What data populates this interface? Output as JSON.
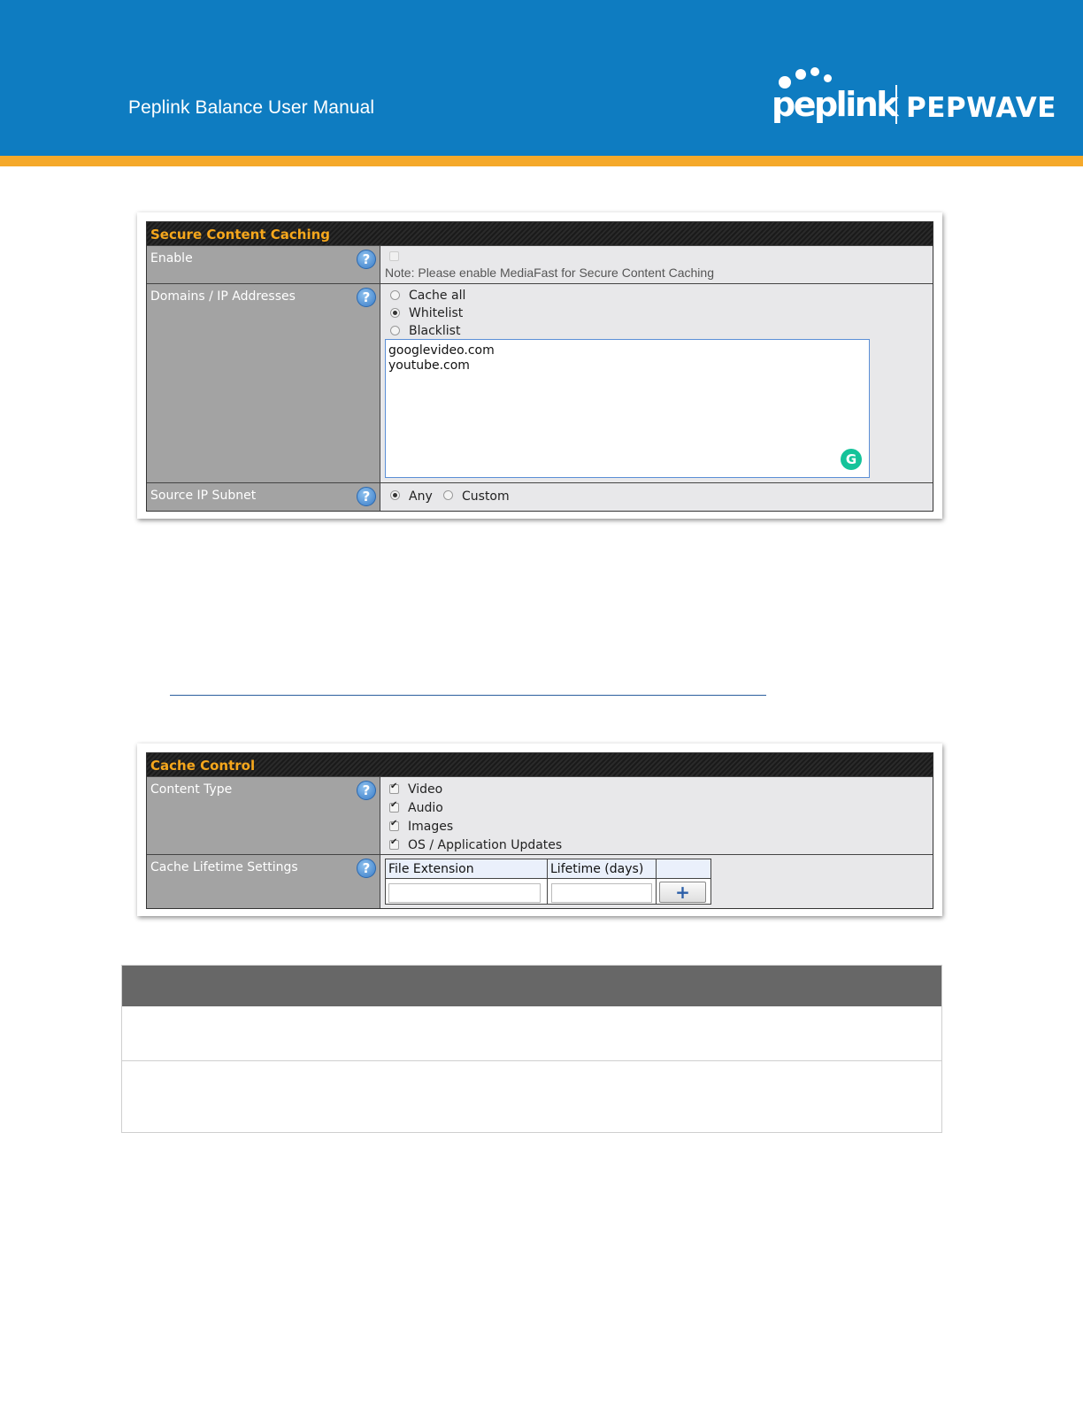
{
  "header": {
    "title": "Peplink Balance User Manual",
    "logo_left": "peplink",
    "logo_right": "PEPWAVE",
    "bg_color": "#0e7cc1",
    "stripe_color": "#f5a92a"
  },
  "secure_caching": {
    "title": "Secure Content Caching",
    "enable": {
      "label": "Enable",
      "note": "Note: Please enable MediaFast for Secure Content Caching",
      "checked": false
    },
    "domains": {
      "label": "Domains / IP Addresses",
      "options": [
        "Cache all",
        "Whitelist",
        "Blacklist"
      ],
      "selected": "Whitelist",
      "textarea_lines": [
        "googlevideo.com",
        "youtube.com"
      ],
      "grammarly_icon": "G"
    },
    "source": {
      "label": "Source IP Subnet",
      "options": [
        "Any",
        "Custom"
      ],
      "selected": "Any"
    }
  },
  "cache_control": {
    "title": "Cache Control",
    "content_type": {
      "label": "Content Type",
      "options": [
        "Video",
        "Audio",
        "Images",
        "OS / Application Updates"
      ]
    },
    "lifetime": {
      "label": "Cache Lifetime Settings",
      "col_ext": "File Extension",
      "col_life": "Lifetime (days)",
      "add_symbol": "+"
    }
  },
  "help_symbol": "?"
}
